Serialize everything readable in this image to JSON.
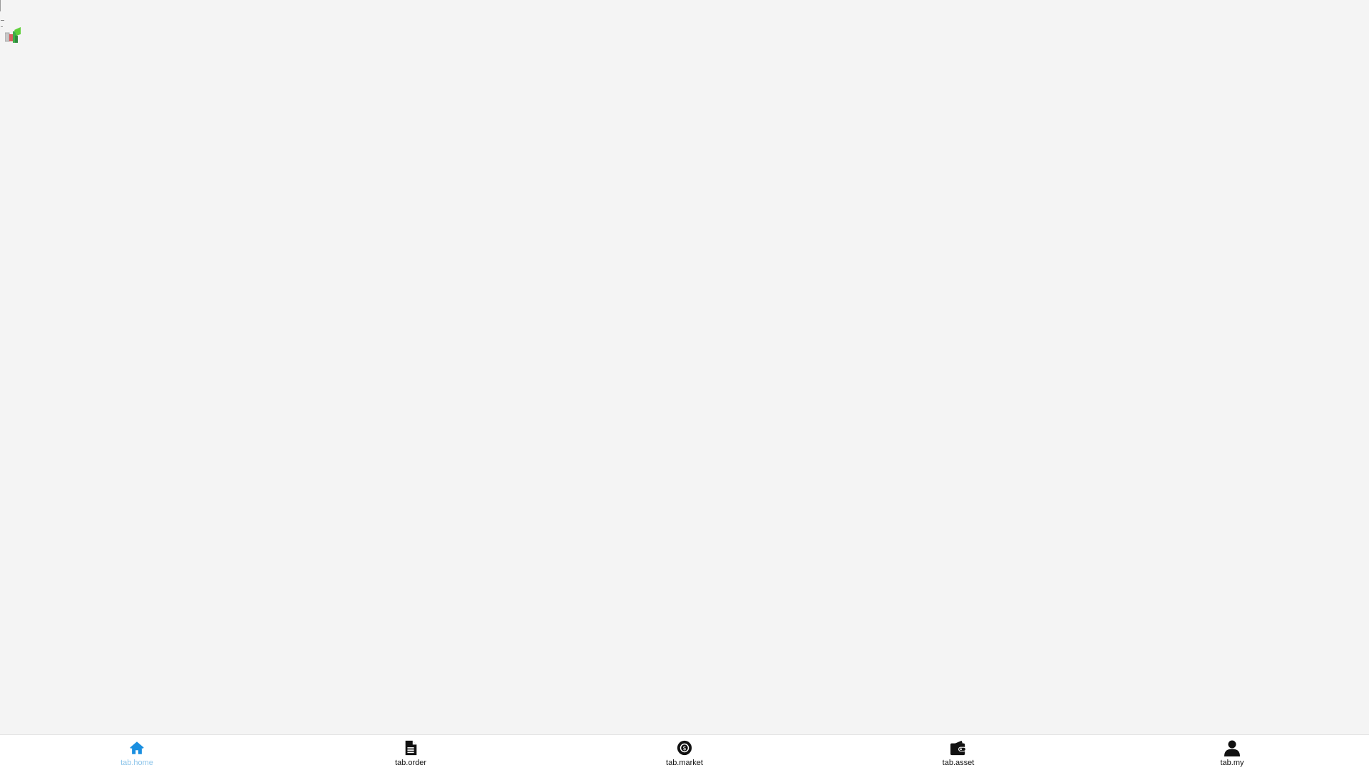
{
  "colors": {
    "background": "#f4f4f4",
    "tabbar_background": "#ffffff",
    "active_icon": "#1a8fe0",
    "active_label": "#8ec5ea",
    "inactive": "#111111"
  },
  "tabs": [
    {
      "label": "tab.home",
      "icon": "home-icon",
      "active": true
    },
    {
      "label": "tab.order",
      "icon": "document-icon",
      "active": false
    },
    {
      "label": "tab.market",
      "icon": "coin-icon",
      "active": false
    },
    {
      "label": "tab.asset",
      "icon": "wallet-icon",
      "active": false
    },
    {
      "label": "tab.my",
      "icon": "user-icon",
      "active": false
    }
  ]
}
